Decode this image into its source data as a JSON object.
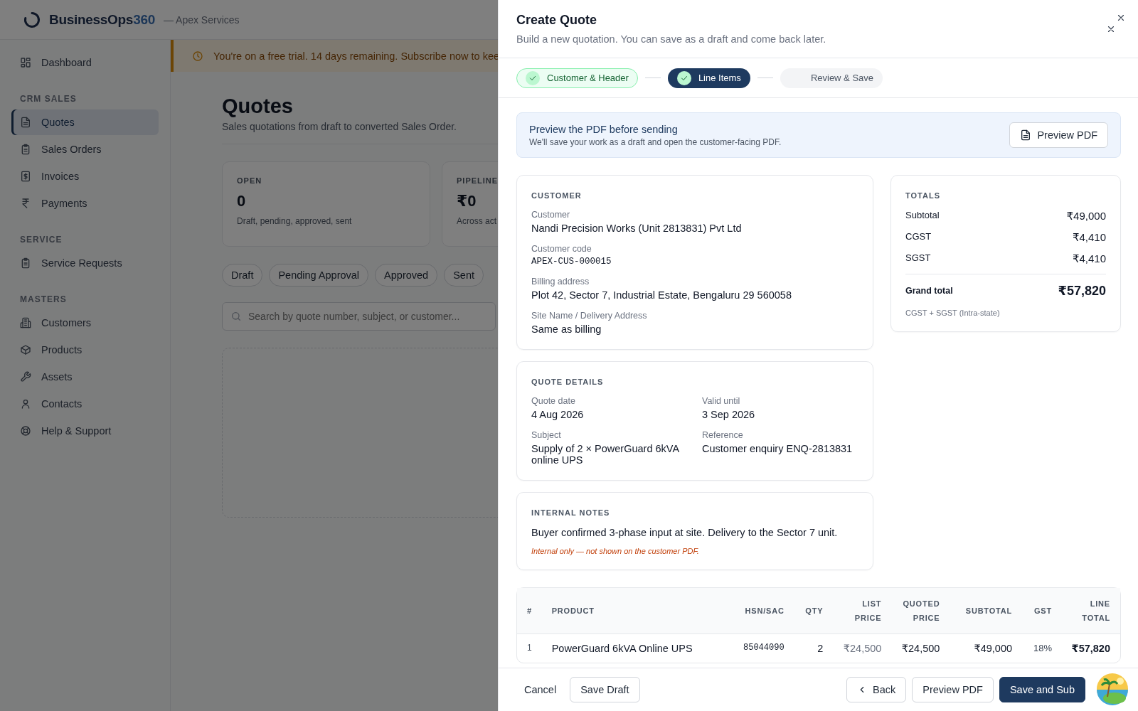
{
  "app": {
    "brand_name": "BusinessOps",
    "brand_number": "360",
    "org": "— Apex Services"
  },
  "sidebar": {
    "sections": [
      {
        "items": [
          {
            "label": "Dashboard",
            "selected": false
          }
        ]
      },
      {
        "title": "CRM SALES",
        "items": [
          {
            "label": "Quotes",
            "selected": true
          },
          {
            "label": "Sales Orders",
            "selected": false
          },
          {
            "label": "Invoices",
            "selected": false
          },
          {
            "label": "Payments",
            "selected": false
          }
        ]
      },
      {
        "title": "SERVICE",
        "items": [
          {
            "label": "Service Requests",
            "selected": false
          }
        ]
      },
      {
        "title": "MASTERS",
        "items": [
          {
            "label": "Customers",
            "selected": false
          },
          {
            "label": "Products",
            "selected": false
          },
          {
            "label": "Assets",
            "selected": false
          },
          {
            "label": "Contacts",
            "selected": false
          },
          {
            "label": "Help & Support",
            "selected": false
          }
        ]
      }
    ]
  },
  "trial_banner": "You're on a free trial. 14 days remaining. Subscribe now to kee",
  "page": {
    "title": "Quotes",
    "subtitle": "Sales quotations from draft to converted Sales Order.",
    "stats": [
      {
        "label": "OPEN",
        "value": "0",
        "note": "Draft, pending, approved, sent"
      },
      {
        "label": "PIPELINE",
        "value": "₹0",
        "note": "Across act"
      }
    ],
    "filters": [
      "Draft",
      "Pending Approval",
      "Approved",
      "Sent"
    ],
    "search": {
      "placeholder": "Search by quote number, subject, or customer..."
    }
  },
  "drawer": {
    "title": "Create Quote",
    "subtitle": "Build a new quotation. You can save as a draft and come back later.",
    "steps": [
      {
        "label": "Customer & Header",
        "done": true,
        "selected": false
      },
      {
        "label": "Line Items",
        "done": true,
        "selected": true
      },
      {
        "label": "Review & Save",
        "done": false,
        "selected": false
      }
    ],
    "preview_banner": {
      "title": "Preview the PDF before sending",
      "text": "We'll save your work as a draft and open the customer-facing PDF.",
      "button": "Preview PDF"
    },
    "customer": {
      "heading": "CUSTOMER",
      "fields": [
        {
          "label": "Customer",
          "value": "Nandi Precision Works (Unit 2813831) Pvt Ltd",
          "kind": "text"
        },
        {
          "label": "Customer code",
          "value": "APEX-CUS-000015",
          "kind": "code"
        },
        {
          "label": "Billing address",
          "value": "Plot 42, Sector 7, Industrial Estate, Bengaluru 29 560058",
          "kind": "text"
        },
        {
          "label": "Site Name / Delivery Address",
          "value": "Same as billing",
          "kind": "text"
        }
      ]
    },
    "quote_details": {
      "heading": "QUOTE DETAILS",
      "fields": [
        {
          "label": "Quote date",
          "value": "4 Aug 2026"
        },
        {
          "label": "Valid until",
          "value": "3 Sep 2026"
        },
        {
          "label": "Subject",
          "value": "Supply of 2 × PowerGuard 6kVA online UPS"
        },
        {
          "label": "Reference",
          "value": "Customer enquiry ENQ-2813831"
        }
      ]
    },
    "internal_notes": {
      "heading": "INTERNAL NOTES",
      "text": "Buyer confirmed 3-phase input at site. Delivery to the Sector 7 unit.",
      "note": "Internal only — not shown on the customer PDF."
    },
    "totals": {
      "heading": "TOTALS",
      "rows": [
        {
          "label": "Subtotal",
          "value": "₹49,000"
        },
        {
          "label": "CGST",
          "value": "₹4,410"
        },
        {
          "label": "SGST",
          "value": "₹4,410"
        }
      ],
      "grand": {
        "label": "Grand total",
        "value": "₹57,820"
      },
      "note": "CGST + SGST (Intra-state)"
    },
    "table": {
      "columns": [
        "#",
        "PRODUCT",
        "HSN/SAC",
        "QTY",
        "LIST PRICE",
        "QUOTED PRICE",
        "SUBTOTAL",
        "GST",
        "LINE TOTAL"
      ],
      "rows": [
        [
          "1",
          "PowerGuard 6kVA Online UPS",
          "85044090",
          "2",
          "₹24,500",
          "₹24,500",
          "₹49,000",
          "18%",
          "₹57,820"
        ]
      ]
    },
    "footer": {
      "left": [
        {
          "label": "Cancel",
          "kind": "ghost"
        },
        {
          "label": "Save Draft",
          "kind": "outline"
        }
      ],
      "right": [
        {
          "label": "Back",
          "kind": "back"
        },
        {
          "label": "Preview PDF",
          "kind": "outline"
        },
        {
          "label": "Save and Sub",
          "kind": "primary"
        }
      ]
    }
  }
}
